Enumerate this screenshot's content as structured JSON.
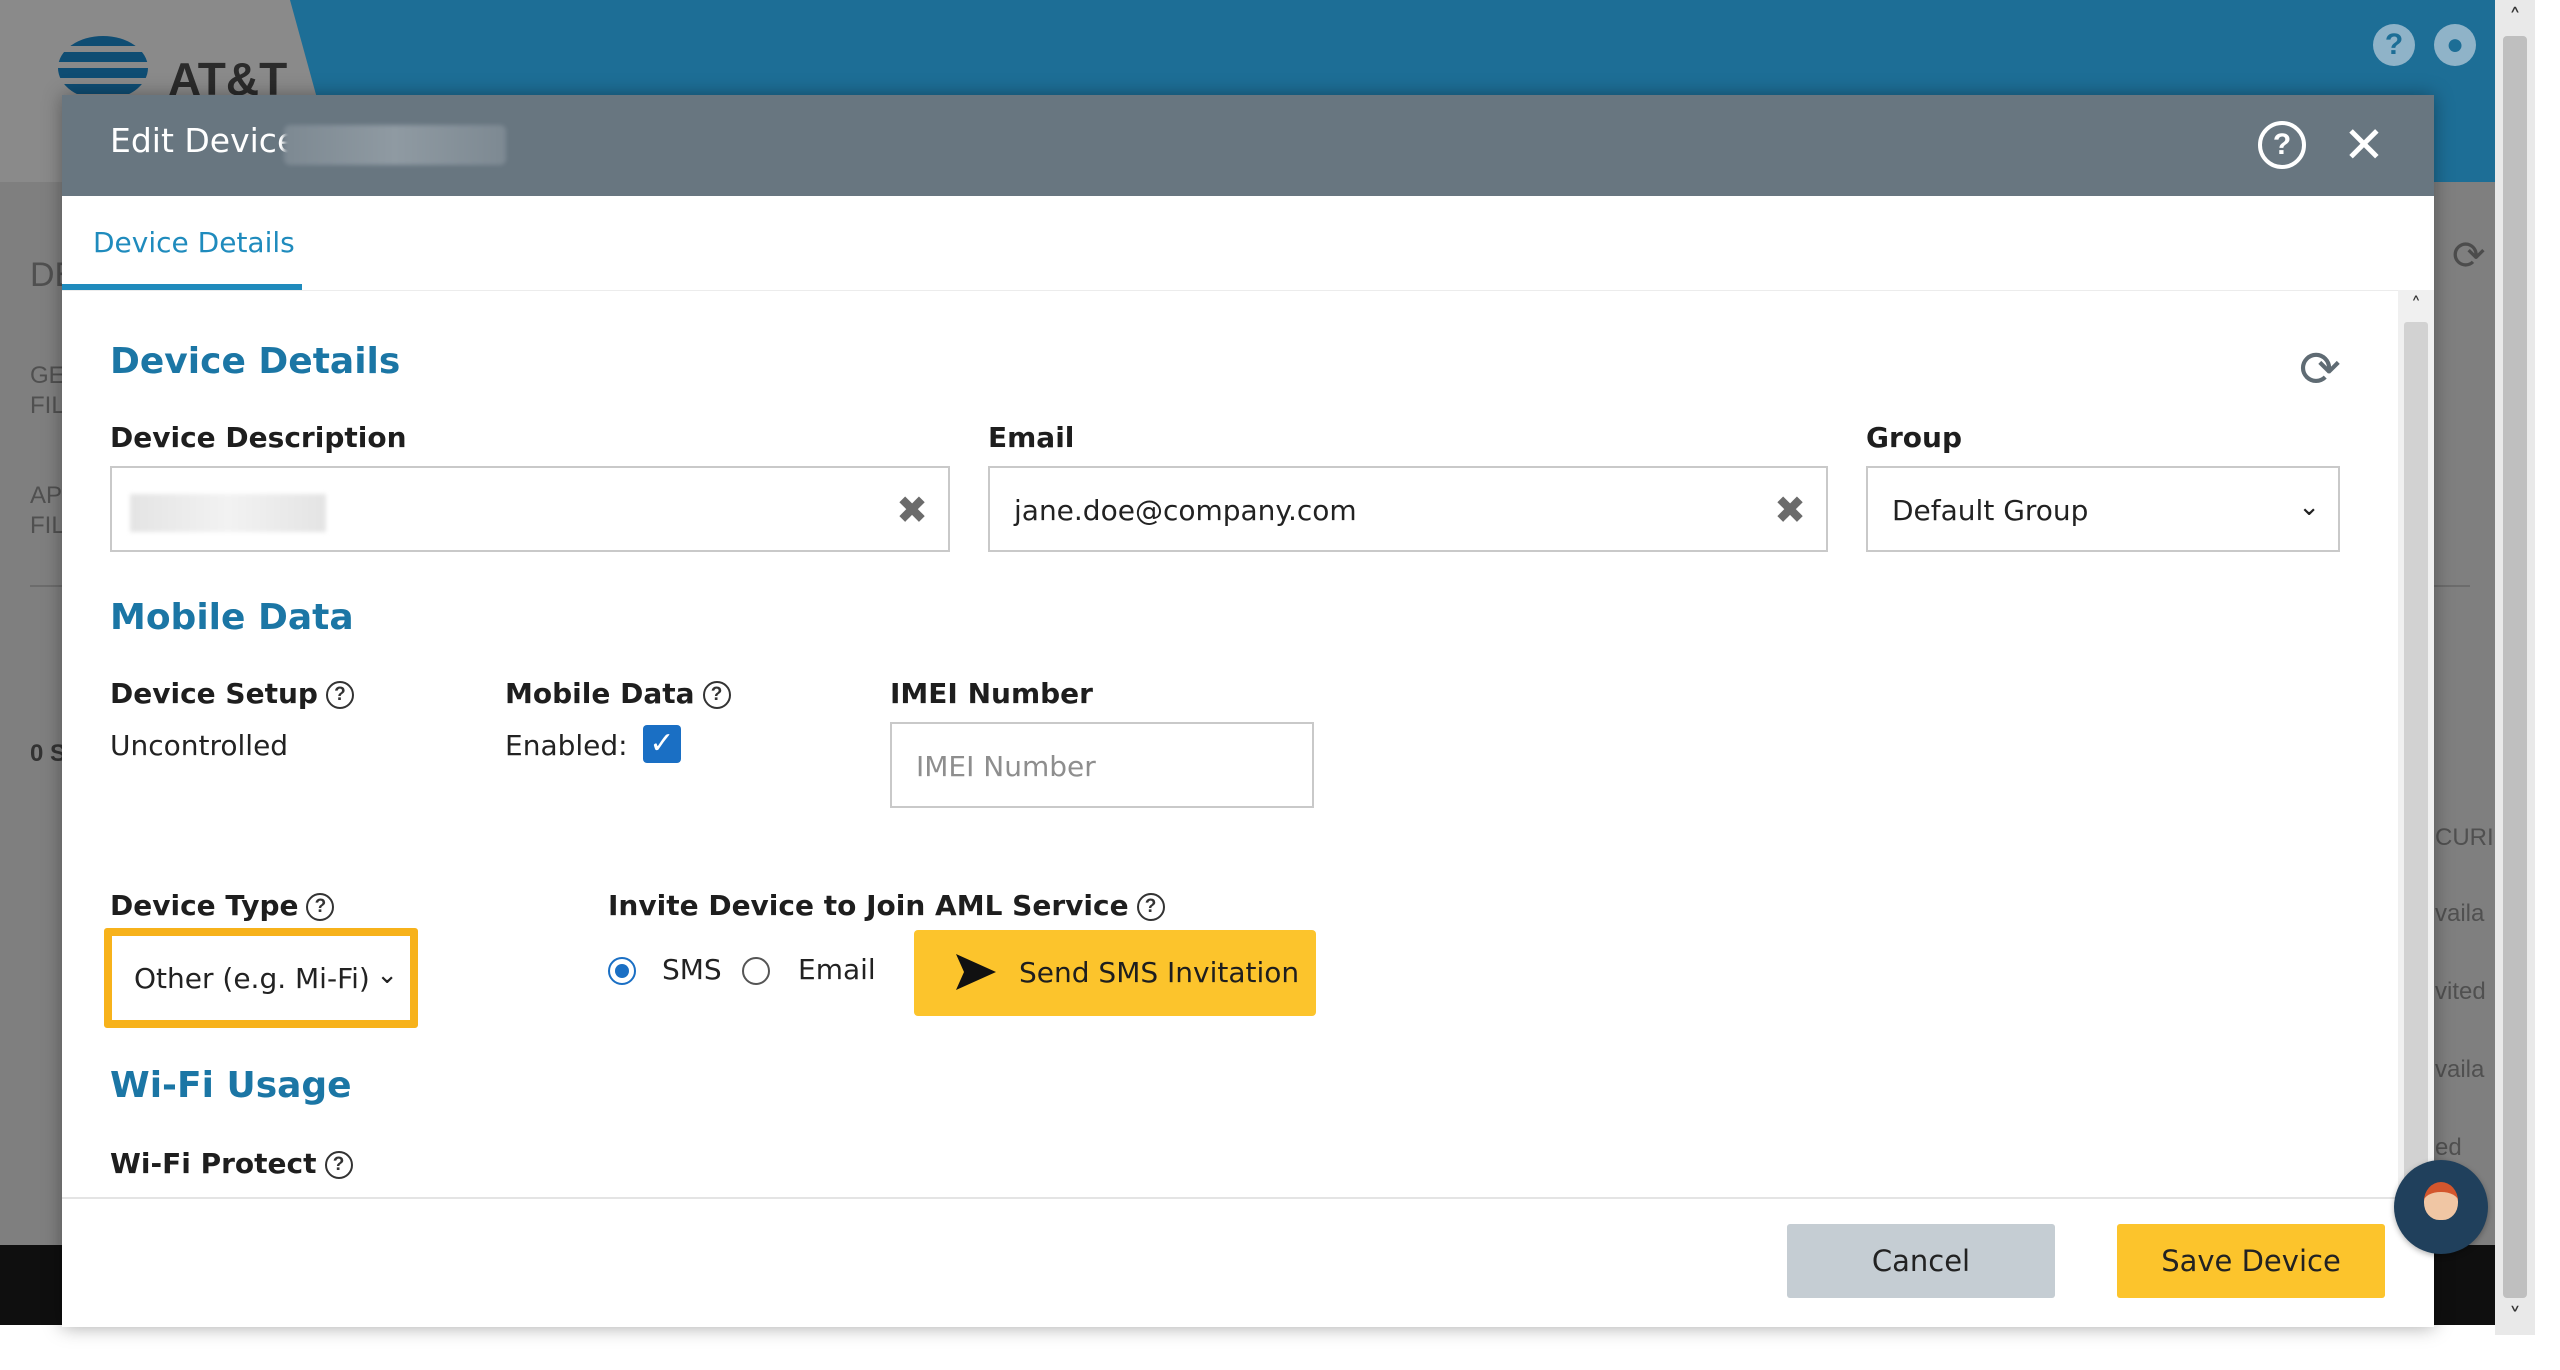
{
  "app": {
    "brand": "AT&T",
    "header_icons": [
      "help-icon",
      "account-icon"
    ],
    "bg_fragments": [
      "DE",
      "GE",
      "FIL",
      "AP",
      "FIL",
      "0 S",
      "CURI",
      "vaila",
      "vited",
      "vaila",
      "ed"
    ]
  },
  "modal": {
    "title": "Edit Device:",
    "tab": "Device Details",
    "sections": {
      "device_details": "Device Details",
      "mobile_data": "Mobile Data",
      "wifi_usage": "Wi-Fi Usage"
    },
    "fields": {
      "device_description": {
        "label": "Device Description",
        "value": ""
      },
      "email": {
        "label": "Email",
        "value": "jane.doe@company.com"
      },
      "group": {
        "label": "Group",
        "value": "Default Group"
      },
      "device_setup": {
        "label": "Device Setup",
        "value": "Uncontrolled"
      },
      "mobile_data": {
        "label": "Mobile Data",
        "enabled_label": "Enabled:",
        "enabled": true
      },
      "imei": {
        "label": "IMEI Number",
        "placeholder": "IMEI Number"
      },
      "device_type": {
        "label": "Device Type",
        "value": "Other (e.g. Mi-Fi)"
      },
      "invite": {
        "label": "Invite Device to Join AML Service",
        "options": [
          "SMS",
          "Email"
        ],
        "selected": "SMS",
        "button": "Send SMS Invitation"
      },
      "wifi_protect": {
        "label": "Wi-Fi Protect"
      }
    },
    "buttons": {
      "cancel": "Cancel",
      "save": "Save Device"
    }
  },
  "colors": {
    "primary_blue": "#1b76a5",
    "accent_yellow": "#fcc42c",
    "header_gray": "#687680",
    "checkbox_blue": "#1a6fc4"
  }
}
